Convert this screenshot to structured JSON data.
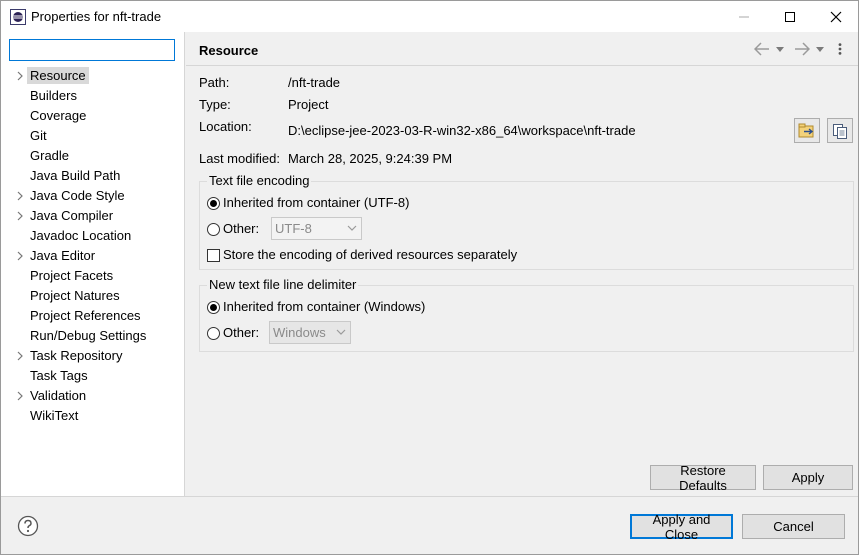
{
  "window": {
    "title": "Properties for nft-trade"
  },
  "filter": {
    "value": "",
    "placeholder": ""
  },
  "tree": [
    {
      "label": "Resource",
      "expandable": true,
      "selected": true
    },
    {
      "label": "Builders",
      "expandable": false
    },
    {
      "label": "Coverage",
      "expandable": false
    },
    {
      "label": "Git",
      "expandable": false
    },
    {
      "label": "Gradle",
      "expandable": false
    },
    {
      "label": "Java Build Path",
      "expandable": false
    },
    {
      "label": "Java Code Style",
      "expandable": true
    },
    {
      "label": "Java Compiler",
      "expandable": true
    },
    {
      "label": "Javadoc Location",
      "expandable": false
    },
    {
      "label": "Java Editor",
      "expandable": true
    },
    {
      "label": "Project Facets",
      "expandable": false
    },
    {
      "label": "Project Natures",
      "expandable": false
    },
    {
      "label": "Project References",
      "expandable": false
    },
    {
      "label": "Run/Debug Settings",
      "expandable": false
    },
    {
      "label": "Task Repository",
      "expandable": true
    },
    {
      "label": "Task Tags",
      "expandable": false
    },
    {
      "label": "Validation",
      "expandable": true
    },
    {
      "label": "WikiText",
      "expandable": false
    }
  ],
  "page": {
    "title": "Resource",
    "path_label": "Path:",
    "path_value": "/nft-trade",
    "type_label": "Type:",
    "type_value": "Project",
    "location_label": "Location:",
    "location_value": "D:\\eclipse-jee-2023-03-R-win32-x86_64\\workspace\\nft-trade",
    "modified_label": "Last modified:",
    "modified_value": "March 28, 2025, 9:24:39 PM"
  },
  "encoding": {
    "title": "Text file encoding",
    "inherited_label": "Inherited from container (UTF-8)",
    "other_label": "Other:",
    "other_value": "UTF-8",
    "derived_label": "Store the encoding of derived resources separately",
    "selected": "inherited",
    "derived_checked": false
  },
  "delimiter": {
    "title": "New text file line delimiter",
    "inherited_label": "Inherited from container (Windows)",
    "other_label": "Other:",
    "other_value": "Windows",
    "selected": "inherited"
  },
  "buttons": {
    "restore_defaults": "Restore Defaults",
    "apply": "Apply",
    "apply_close": "Apply and Close",
    "cancel": "Cancel"
  },
  "icons": {
    "app": "eclipse-icon",
    "back": "back-arrow-icon",
    "forward": "forward-arrow-icon",
    "menu": "view-menu-icon",
    "open_location": "show-in-explorer-icon",
    "copy_path": "copy-path-icon",
    "help": "help-icon"
  },
  "colors": {
    "focus": "#0078d7",
    "selection": "#d9d9d9",
    "panel": "#f0f0f0"
  }
}
